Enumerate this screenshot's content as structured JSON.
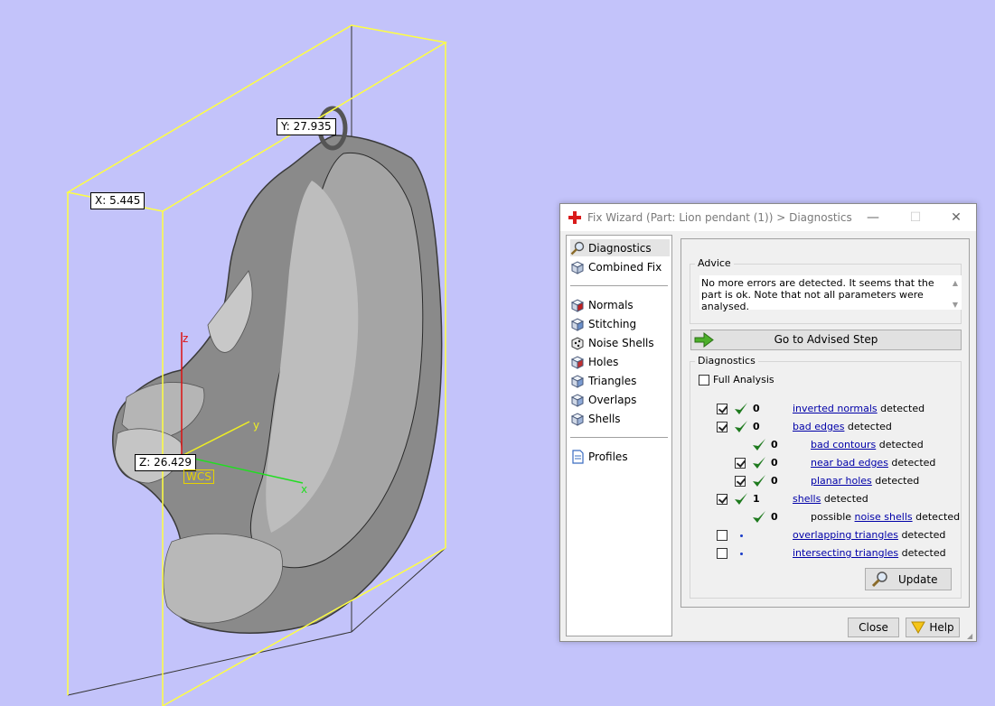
{
  "viewport": {
    "dimensions": {
      "x": "X: 5.445",
      "y": "Y: 27.935",
      "z": "Z: 26.429"
    },
    "wcs_label": "WCS",
    "axes": {
      "x": "x",
      "y": "y",
      "z": "z"
    },
    "colors": {
      "background": "#c3c3fa",
      "bounding_box": "#ffff40",
      "axis_x": "#22dd22",
      "axis_y": "#eeee22",
      "axis_z": "#dd1111"
    }
  },
  "dialog": {
    "title": "Fix Wizard (Part: Lion pendant (1)) > Diagnostics",
    "window_controls": {
      "minimize": "—",
      "maximize": "☐",
      "close": "✕"
    },
    "nav": {
      "top_items": [
        {
          "label": "Diagnostics",
          "icon": "magnifier-icon",
          "selected": true
        },
        {
          "label": "Combined Fix",
          "icon": "cube-icon"
        }
      ],
      "fix_items": [
        {
          "label": "Normals",
          "icon": "normals-cube-icon"
        },
        {
          "label": "Stitching",
          "icon": "stitching-cube-icon"
        },
        {
          "label": "Noise Shells",
          "icon": "noise-shells-icon"
        },
        {
          "label": "Holes",
          "icon": "holes-cube-icon"
        },
        {
          "label": "Triangles",
          "icon": "triangles-cube-icon"
        },
        {
          "label": "Overlaps",
          "icon": "overlaps-cube-icon"
        },
        {
          "label": "Shells",
          "icon": "shells-cube-icon"
        }
      ],
      "profiles_item": {
        "label": "Profiles",
        "icon": "document-icon"
      }
    },
    "advice": {
      "group_title": "Advice",
      "text": "No more errors are detected. It seems that the part is ok. Note that not all parameters were analysed.",
      "go_button": "Go to Advised Step"
    },
    "diagnostics": {
      "group_title": "Diagnostics",
      "full_analysis_label": "Full Analysis",
      "full_analysis_checked": false,
      "rows": [
        {
          "checked": true,
          "has_checkbox": true,
          "status": "ok",
          "count": "0",
          "link": "inverted normals",
          "suffix": " detected"
        },
        {
          "checked": true,
          "has_checkbox": true,
          "status": "ok",
          "count": "0",
          "link": "bad edges",
          "suffix": " detected"
        },
        {
          "has_checkbox": false,
          "status": "ok",
          "count": "0",
          "link": "bad contours",
          "suffix": " detected",
          "indent": true
        },
        {
          "checked": true,
          "has_checkbox": true,
          "status": "ok",
          "count": "0",
          "link": "near bad edges",
          "suffix": " detected",
          "indent": true
        },
        {
          "checked": true,
          "has_checkbox": true,
          "status": "ok",
          "count": "0",
          "link": "planar holes",
          "suffix": " detected",
          "indent": true
        },
        {
          "checked": true,
          "has_checkbox": true,
          "status": "ok",
          "count": "1",
          "link": "shells",
          "suffix": " detected"
        },
        {
          "has_checkbox": false,
          "status": "ok",
          "count": "0",
          "prefix": "possible ",
          "link": "noise shells",
          "suffix": " detected",
          "indent": true
        },
        {
          "checked": false,
          "has_checkbox": true,
          "status": "pending",
          "count": "",
          "link": "overlapping triangles",
          "suffix": " detected"
        },
        {
          "checked": false,
          "has_checkbox": true,
          "status": "pending",
          "count": "",
          "link": "intersecting triangles",
          "suffix": " detected"
        }
      ],
      "update_button": "Update"
    },
    "footer": {
      "close_button": "Close",
      "help_button": "Help"
    }
  }
}
